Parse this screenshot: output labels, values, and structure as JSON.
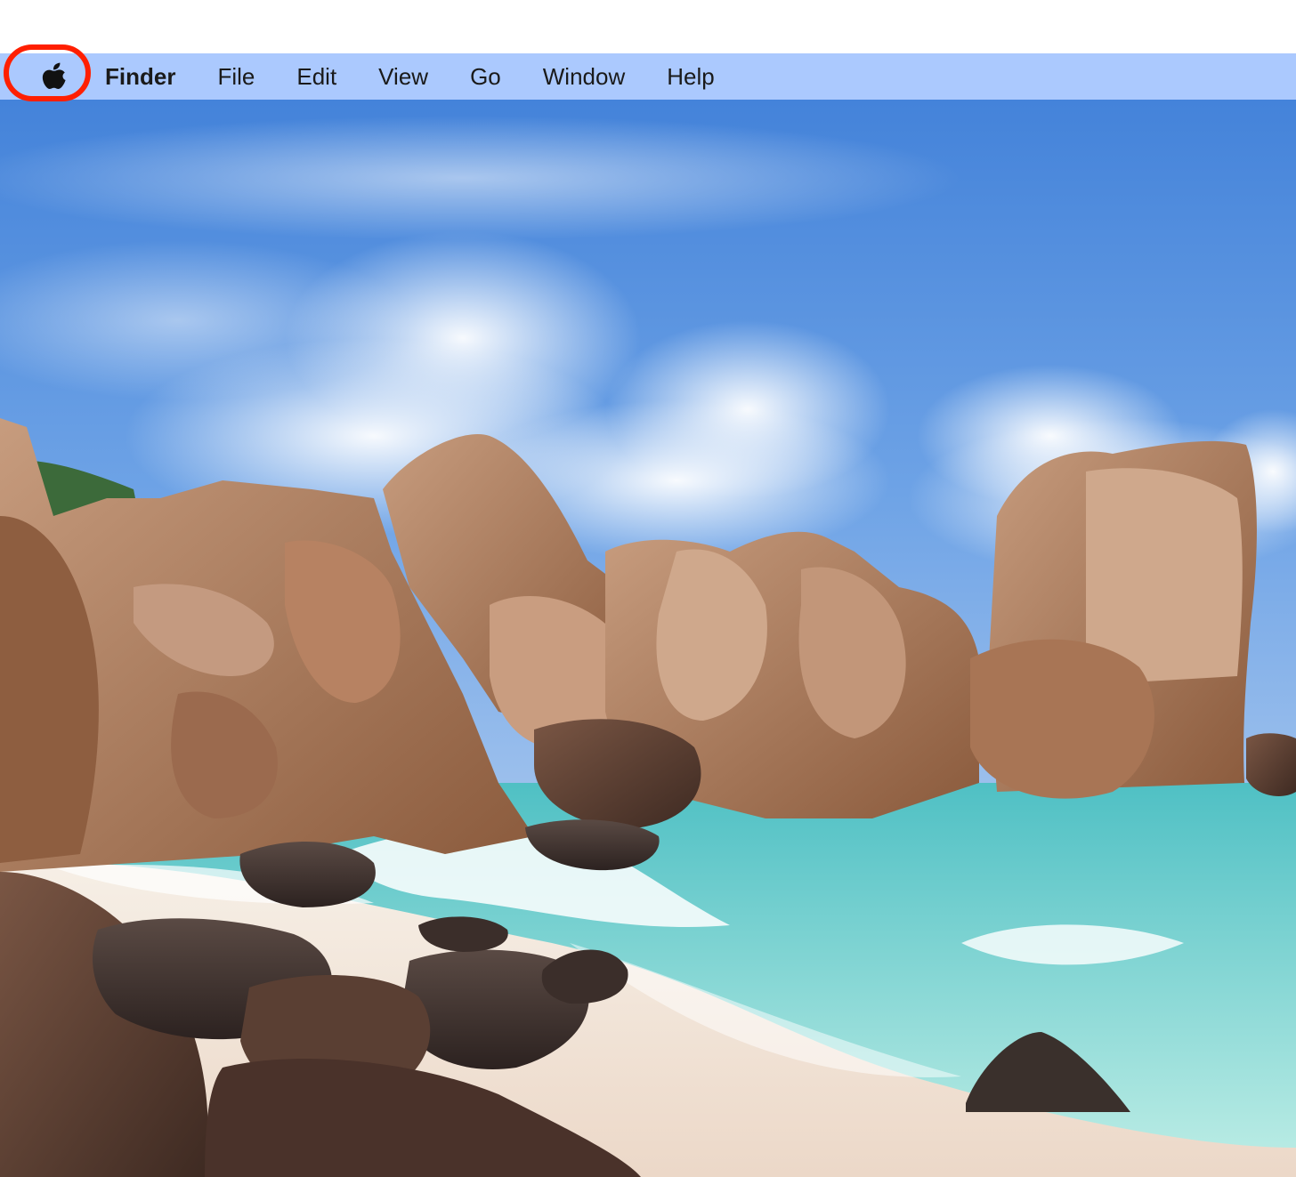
{
  "menubar": {
    "apple_icon": "apple-logo-icon",
    "app_name": "Finder",
    "items": [
      {
        "label": "File"
      },
      {
        "label": "Edit"
      },
      {
        "label": "View"
      },
      {
        "label": "Go"
      },
      {
        "label": "Window"
      },
      {
        "label": "Help"
      }
    ],
    "highlight_color": "#ff1f00",
    "bar_color": "#b0ccff"
  },
  "wallpaper": {
    "sky_color": "#4a86d8",
    "rock_color": "#a9775a",
    "sea_color": "#6fd0c8"
  }
}
